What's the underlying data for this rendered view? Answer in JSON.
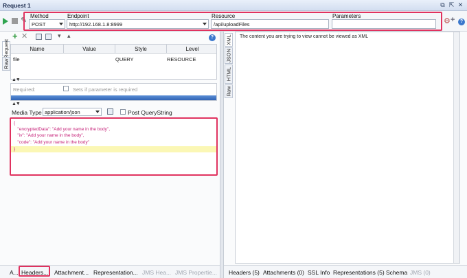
{
  "window": {
    "title": "Request 1",
    "controls": [
      "restore-icon",
      "detach-icon",
      "close-icon"
    ]
  },
  "toolbar": {
    "method_label": "Method",
    "method_value": "POST",
    "endpoint_label": "Endpoint",
    "endpoint_value": "http://192.168.1.8:8999",
    "resource_label": "Resource",
    "resource_value": "/api/uploadFiles",
    "parameters_label": "Parameters",
    "parameters_value": ""
  },
  "request_tabs": [
    "Request",
    "Raw"
  ],
  "params_table": {
    "headers": [
      "Name",
      "Value",
      "Style",
      "Level"
    ],
    "rows": [
      {
        "name": "file",
        "value": "",
        "style": "QUERY",
        "level": "RESOURCE"
      }
    ]
  },
  "param_props": {
    "required_label": "Required:",
    "sets_label": "Sets if parameter is required"
  },
  "media": {
    "label": "Media Type",
    "value": "application/json",
    "post_qs_label": "Post QueryString"
  },
  "body_lines": [
    "{",
    "   \"encryptedData\": \"Add your name in the body\",",
    "   \"iv\": \"Add your name in the body\",",
    "   \"code\": \"Add your name in the body\"",
    "}"
  ],
  "left_bottom_tabs": [
    "A...",
    "Headers...",
    "Attachment...",
    "Representation...",
    "JMS Hea...",
    "JMS Propertie..."
  ],
  "response_tabs": [
    "XML",
    "JSON",
    "HTML",
    "Raw"
  ],
  "response_message": "The content you are trying to view cannot be viewed as XML",
  "right_bottom_tabs": [
    "Headers (5)",
    "Attachments (0)",
    "SSL Info",
    "Representations (5)",
    "Schema",
    "JMS (0)"
  ],
  "colors": {
    "highlight": "#e0325f",
    "body_text": "#c41a74",
    "play": "#2ea44f"
  }
}
